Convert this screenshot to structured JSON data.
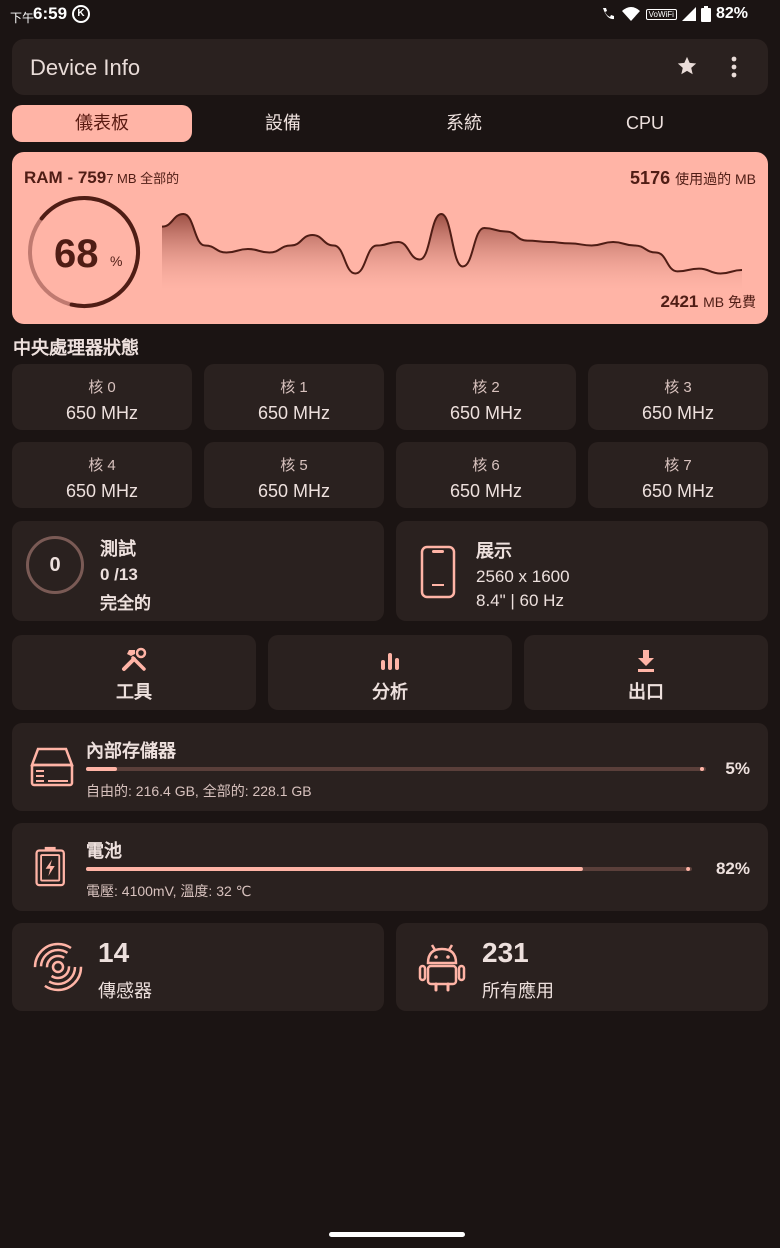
{
  "status_bar": {
    "time_prefix": "下午",
    "time": "6:59",
    "badge": "K",
    "network_label": "VoWiFi",
    "battery": "82%"
  },
  "app": {
    "title": "Device Info",
    "icons": {
      "favorite": "star-icon",
      "menu": "more-vert-icon"
    }
  },
  "tabs": [
    {
      "label": "儀表板",
      "active": true
    },
    {
      "label": "設備",
      "active": false
    },
    {
      "label": "系統",
      "active": false
    },
    {
      "label": "CPU",
      "active": false
    }
  ],
  "ram": {
    "title_prefix": "RAM - 759",
    "title_suffix": "7 MB 全部的",
    "used_value": "5176",
    "used_label": "使用過的 MB",
    "free_value": "2421",
    "free_label": "MB 免費",
    "percent": "68",
    "percent_sign": "%",
    "usage_fraction": 0.68,
    "history": [
      0.82,
      1.0,
      0.55,
      0.45,
      0.5,
      0.45,
      0.55,
      0.7,
      0.55,
      0.15,
      0.55,
      0.6,
      0.35,
      1.0,
      0.25,
      0.8,
      0.75,
      0.62,
      0.6,
      0.58,
      0.55,
      0.6,
      0.55,
      0.45,
      0.18,
      0.22,
      0.15,
      0.2
    ]
  },
  "cpu_status": {
    "heading": "中央處理器狀態",
    "cores": [
      {
        "label": "核 0",
        "freq": "650 MHz"
      },
      {
        "label": "核 1",
        "freq": "650 MHz"
      },
      {
        "label": "核 2",
        "freq": "650 MHz"
      },
      {
        "label": "核 3",
        "freq": "650 MHz"
      },
      {
        "label": "核 4",
        "freq": "650 MHz"
      },
      {
        "label": "核 5",
        "freq": "650 MHz"
      },
      {
        "label": "核 6",
        "freq": "650 MHz"
      },
      {
        "label": "核 7",
        "freq": "650 MHz"
      }
    ]
  },
  "tests": {
    "count": "0",
    "title": "測試",
    "progress": "0 /13",
    "status": "完全的"
  },
  "display": {
    "title": "展示",
    "resolution": "2560 x 1600",
    "details": "8.4\" | 60 Hz",
    "icon": "phone-icon"
  },
  "tools": [
    {
      "label": "工具",
      "icon": "tools-icon"
    },
    {
      "label": "分析",
      "icon": "bar-chart-icon"
    },
    {
      "label": "出口",
      "icon": "download-icon"
    }
  ],
  "storage": {
    "title": "內部存儲器",
    "percent": "5%",
    "fraction": 0.05,
    "detail": "自由的: 216.4 GB,  全部的: 228.1 GB",
    "icon": "storage-icon"
  },
  "battery": {
    "title": "電池",
    "percent": "82%",
    "fraction": 0.82,
    "detail": "電壓: 4100mV,  溫度: 32 ℃",
    "icon": "battery-icon"
  },
  "sensors": {
    "count": "14",
    "label": "傳感器",
    "icon": "sensor-icon"
  },
  "apps": {
    "count": "231",
    "label": "所有應用",
    "icon": "android-icon"
  },
  "colors": {
    "accent": "#ffb4a6",
    "accent_dark": "#4f1d15",
    "background": "#1b1413",
    "surface": "#2a211f",
    "track": "#5a3f3a"
  }
}
